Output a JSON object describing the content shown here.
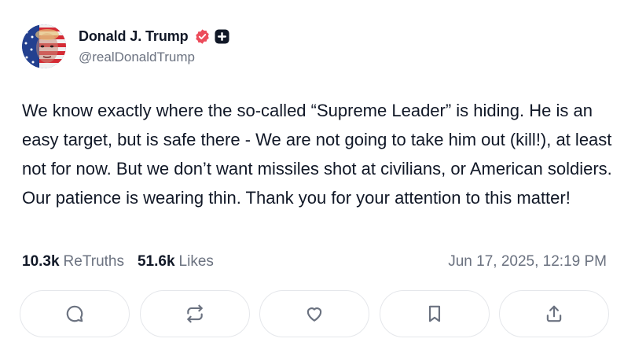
{
  "author": {
    "name": "Donald J. Trump",
    "handle": "@realDonaldTrump",
    "verified_color": "#ec4c5b"
  },
  "post": {
    "text": "We know exactly where the so-called “Supreme Leader” is hiding. He is an easy target, but is safe there - We are not going to take him out (kill!), at least not for now. But we don’t want missiles shot at civilians, or American soldiers. Our patience is wearing thin. Thank you for your attention to this matter!"
  },
  "stats": {
    "retruths_count": "10.3k",
    "retruths_label": "ReTruths",
    "likes_count": "51.6k",
    "likes_label": "Likes",
    "timestamp": "Jun 17, 2025, 12:19 PM"
  },
  "actions": [
    {
      "name": "reply",
      "icon": "comment-icon"
    },
    {
      "name": "retruth",
      "icon": "repost-icon"
    },
    {
      "name": "like",
      "icon": "heart-icon"
    },
    {
      "name": "bookmark",
      "icon": "bookmark-icon"
    },
    {
      "name": "share",
      "icon": "share-icon"
    }
  ]
}
